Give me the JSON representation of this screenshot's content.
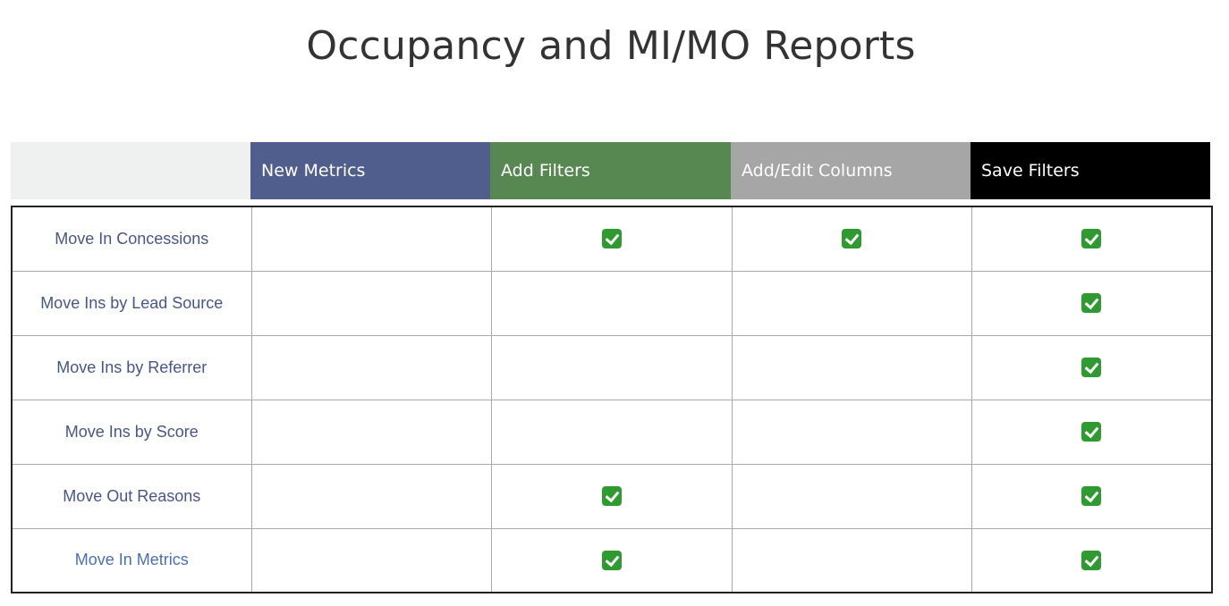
{
  "title": "Occupancy and MI/MO Reports",
  "colors": {
    "new_metrics": "#4f5e8c",
    "add_filters": "#578852",
    "add_edit_columns": "#a6a6a6",
    "save_filters": "#000000",
    "label_text": "#465787",
    "check": "#2f9a2f"
  },
  "columns": [
    "New Metrics",
    "Add Filters",
    "Add/Edit Columns",
    "Save Filters"
  ],
  "check_icon": "green-check-box",
  "rows": [
    {
      "label": "Move In Concessions",
      "new_metrics": false,
      "add_filters": true,
      "add_edit_columns": true,
      "save_filters": true
    },
    {
      "label": "Move Ins by Lead Source",
      "new_metrics": false,
      "add_filters": false,
      "add_edit_columns": false,
      "save_filters": true
    },
    {
      "label": "Move Ins by Referrer",
      "new_metrics": false,
      "add_filters": false,
      "add_edit_columns": false,
      "save_filters": true
    },
    {
      "label": "Move Ins by Score",
      "new_metrics": false,
      "add_filters": false,
      "add_edit_columns": false,
      "save_filters": true
    },
    {
      "label": "Move Out Reasons",
      "new_metrics": false,
      "add_filters": true,
      "add_edit_columns": false,
      "save_filters": true
    },
    {
      "label": "Move In Metrics",
      "new_metrics": false,
      "add_filters": true,
      "add_edit_columns": false,
      "save_filters": true
    }
  ]
}
